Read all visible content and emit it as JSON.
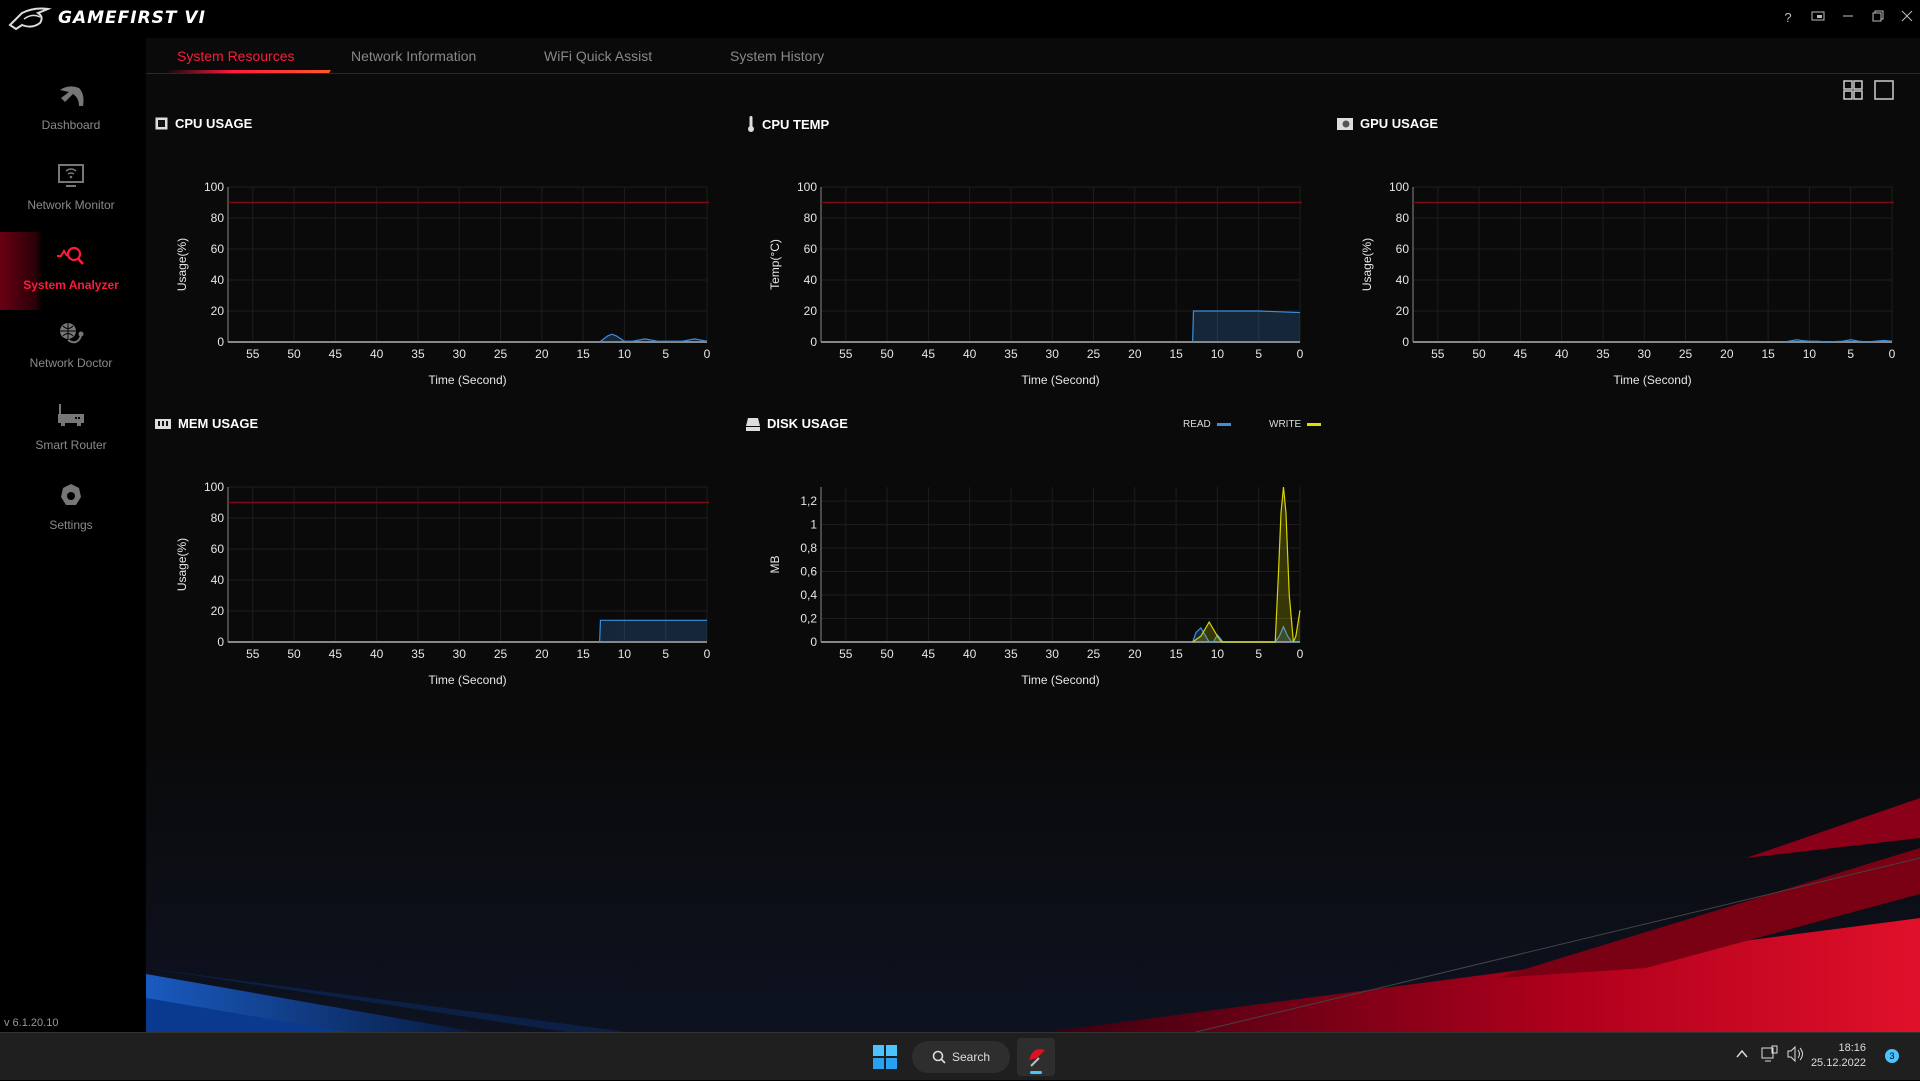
{
  "app": {
    "title": "GAMEFIRST VI",
    "version": "v 6.1.20.10"
  },
  "window_controls": {
    "help": "?"
  },
  "sidebar": {
    "items": [
      {
        "label": "Dashboard",
        "icon": "dashboard-icon"
      },
      {
        "label": "Network Monitor",
        "icon": "network-monitor-icon"
      },
      {
        "label": "System Analyzer",
        "icon": "system-analyzer-icon",
        "active": true
      },
      {
        "label": "Network Doctor",
        "icon": "network-doctor-icon"
      },
      {
        "label": "Smart Router",
        "icon": "router-icon"
      },
      {
        "label": "Settings",
        "icon": "gear-icon"
      }
    ]
  },
  "tabs": [
    {
      "label": "System Resources",
      "active": true
    },
    {
      "label": "Network Information"
    },
    {
      "label": "WiFi Quick Assist"
    },
    {
      "label": "System History"
    }
  ],
  "panels": {
    "cpu_usage": "CPU USAGE",
    "cpu_temp": "CPU TEMP",
    "gpu_usage": "GPU USAGE",
    "mem_usage": "MEM USAGE",
    "disk_usage": "DISK USAGE",
    "legend_read": "READ",
    "legend_write": "WRITE"
  },
  "colors": {
    "accent": "#ff1a3c",
    "read": "#3a8fe0",
    "write": "#e0e000",
    "threshold": "#7a0a14"
  },
  "chart_data": [
    {
      "id": "cpu",
      "type": "area",
      "title": "CPU USAGE",
      "xlabel": "Time (Second)",
      "ylabel": "Usage(%)",
      "xlim": [
        58,
        0
      ],
      "ylim": [
        0,
        100
      ],
      "threshold": 90,
      "xticks": [
        "55",
        "50",
        "45",
        "40",
        "35",
        "30",
        "25",
        "20",
        "15",
        "10",
        "5",
        "0"
      ],
      "yticks": [
        "0",
        "20",
        "40",
        "60",
        "80",
        "100"
      ],
      "series": [
        {
          "name": "CPU",
          "color": "#3a8fe0",
          "x": [
            13,
            12,
            11.5,
            11,
            10,
            9,
            8,
            7.5,
            7,
            6,
            5,
            4,
            3,
            2,
            1.5,
            1,
            0
          ],
          "y": [
            0,
            4,
            5,
            4,
            0.5,
            0.5,
            1.5,
            2,
            1.5,
            0.5,
            0.5,
            0.5,
            0.5,
            1.5,
            2,
            1.5,
            0.5
          ]
        }
      ]
    },
    {
      "id": "temp",
      "type": "area",
      "title": "CPU TEMP",
      "xlabel": "Time (Second)",
      "ylabel": "Temp(°C)",
      "xlim": [
        58,
        0
      ],
      "ylim": [
        0,
        100
      ],
      "threshold": 90,
      "xticks": [
        "55",
        "50",
        "45",
        "40",
        "35",
        "30",
        "25",
        "20",
        "15",
        "10",
        "5",
        "0"
      ],
      "yticks": [
        "0",
        "20",
        "40",
        "60",
        "80",
        "100"
      ],
      "series": [
        {
          "name": "Temp",
          "color": "#3a8fe0",
          "x": [
            13,
            12.9,
            10,
            5,
            0
          ],
          "y": [
            0,
            20,
            20,
            20,
            19
          ]
        }
      ]
    },
    {
      "id": "gpu",
      "type": "area",
      "title": "GPU USAGE",
      "xlabel": "Time (Second)",
      "ylabel": "Usage(%)",
      "xlim": [
        58,
        0
      ],
      "ylim": [
        0,
        100
      ],
      "threshold": 90,
      "xticks": [
        "55",
        "50",
        "45",
        "40",
        "35",
        "30",
        "25",
        "20",
        "15",
        "10",
        "5",
        "0"
      ],
      "yticks": [
        "0",
        "20",
        "40",
        "60",
        "80",
        "100"
      ],
      "series": [
        {
          "name": "GPU",
          "color": "#3a8fe0",
          "x": [
            13,
            12,
            11.5,
            11,
            10,
            9,
            8,
            6,
            5,
            4,
            3,
            2,
            1,
            0
          ],
          "y": [
            0,
            1,
            1.5,
            1,
            0.5,
            0.5,
            0,
            0.5,
            1.5,
            0.5,
            0,
            0.5,
            1,
            0.5
          ]
        }
      ]
    },
    {
      "id": "mem",
      "type": "area",
      "title": "MEM USAGE",
      "xlabel": "Time (Second)",
      "ylabel": "Usage(%)",
      "xlim": [
        58,
        0
      ],
      "ylim": [
        0,
        100
      ],
      "threshold": 90,
      "xticks": [
        "55",
        "50",
        "45",
        "40",
        "35",
        "30",
        "25",
        "20",
        "15",
        "10",
        "5",
        "0"
      ],
      "yticks": [
        "0",
        "20",
        "40",
        "60",
        "80",
        "100"
      ],
      "series": [
        {
          "name": "MEM",
          "color": "#3a8fe0",
          "x": [
            13,
            12.9,
            10,
            5,
            0
          ],
          "y": [
            0,
            14,
            14,
            14,
            14
          ]
        }
      ]
    },
    {
      "id": "disk",
      "type": "area",
      "title": "DISK USAGE",
      "xlabel": "Time (Second)",
      "ylabel": "MB",
      "xlim": [
        58,
        0
      ],
      "ylim": [
        0,
        1.32
      ],
      "xticks": [
        "55",
        "50",
        "45",
        "40",
        "35",
        "30",
        "25",
        "20",
        "15",
        "10",
        "5",
        "0"
      ],
      "yticks": [
        "0",
        "0,2",
        "0,4",
        "0,6",
        "0,8",
        "1",
        "1,2"
      ],
      "legend": "top-right",
      "series": [
        {
          "name": "READ",
          "color": "#3a8fe0",
          "x": [
            13,
            12.6,
            12,
            11,
            10.5,
            10,
            9.3,
            3,
            2.5,
            2,
            1.5,
            1,
            0
          ],
          "y": [
            0,
            0.08,
            0.12,
            0,
            0,
            0.06,
            0,
            0,
            0.05,
            0.13,
            0.05,
            0,
            0
          ]
        },
        {
          "name": "WRITE",
          "color": "#d8d400",
          "x": [
            13,
            12,
            11,
            10,
            9.5,
            3,
            2.6,
            2.3,
            2,
            1.7,
            1.3,
            0.8,
            0.5,
            0
          ],
          "y": [
            0,
            0.05,
            0.17,
            0.05,
            0,
            0,
            0.6,
            1.1,
            1.32,
            1.1,
            0.4,
            0,
            0.05,
            0.27
          ]
        }
      ]
    }
  ],
  "taskbar": {
    "search": "Search",
    "time": "18:16",
    "date": "25.12.2022",
    "notifications": "3"
  }
}
